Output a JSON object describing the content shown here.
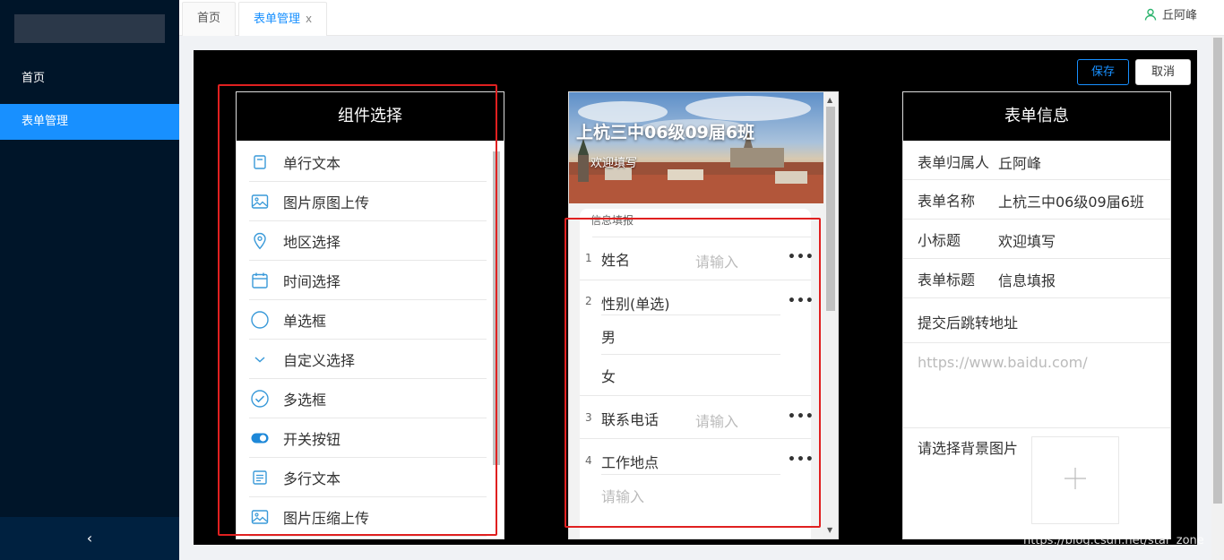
{
  "sidebar": {
    "items": [
      {
        "label": "首页"
      },
      {
        "label": "表单管理"
      }
    ],
    "collapse_glyph": "‹"
  },
  "tabs": [
    {
      "label": "首页"
    },
    {
      "label": "表单管理",
      "close": "x"
    }
  ],
  "user": {
    "name": "丘阿峰",
    "icon": "user-icon"
  },
  "toolbar": {
    "save_label": "保存",
    "cancel_label": "取消"
  },
  "components": {
    "title": "组件选择",
    "items": [
      {
        "label": "单行文本",
        "icon": "doc-icon"
      },
      {
        "label": "图片原图上传",
        "icon": "image-icon"
      },
      {
        "label": "地区选择",
        "icon": "location-pin-icon"
      },
      {
        "label": "时间选择",
        "icon": "calendar-icon"
      },
      {
        "label": "单选框",
        "icon": "radio-circle-icon"
      },
      {
        "label": "自定义选择",
        "icon": "chevron-down-icon"
      },
      {
        "label": "多选框",
        "icon": "check-circle-icon"
      },
      {
        "label": "开关按钮",
        "icon": "toggle-icon"
      },
      {
        "label": "多行文本",
        "icon": "multiline-doc-icon"
      },
      {
        "label": "图片压缩上传",
        "icon": "image-icon"
      }
    ]
  },
  "preview": {
    "banner_title": "上杭三中06级09届6班",
    "banner_subtitle": "欢迎填写",
    "form_title": "信息填报",
    "questions": [
      {
        "num": "1",
        "label": "姓名",
        "placeholder": "请输入"
      },
      {
        "num": "2",
        "label": "性别(单选)",
        "options": [
          "男",
          "女"
        ]
      },
      {
        "num": "3",
        "label": "联系电话",
        "placeholder": "请输入"
      },
      {
        "num": "4",
        "label": "工作地点",
        "placeholder": "请输入"
      }
    ],
    "more_glyph": "•••"
  },
  "form_info": {
    "title": "表单信息",
    "rows": [
      {
        "key": "表单归属人",
        "value": "丘阿峰"
      },
      {
        "key": "表单名称",
        "value": "上杭三中06级09届6班"
      },
      {
        "key": "小标题",
        "value": "欢迎填写"
      },
      {
        "key": "表单标题",
        "value": "信息填报"
      },
      {
        "key": "提交后跳转地址",
        "value": ""
      }
    ],
    "redirect_placeholder": "https://www.baidu.com/",
    "bg_image_label": "请选择背景图片"
  },
  "watermark": "https://blog.csdn.net/star_zone",
  "colors": {
    "accent": "#1890ff",
    "sidebar": "#001529",
    "highlight": "#e02020"
  }
}
